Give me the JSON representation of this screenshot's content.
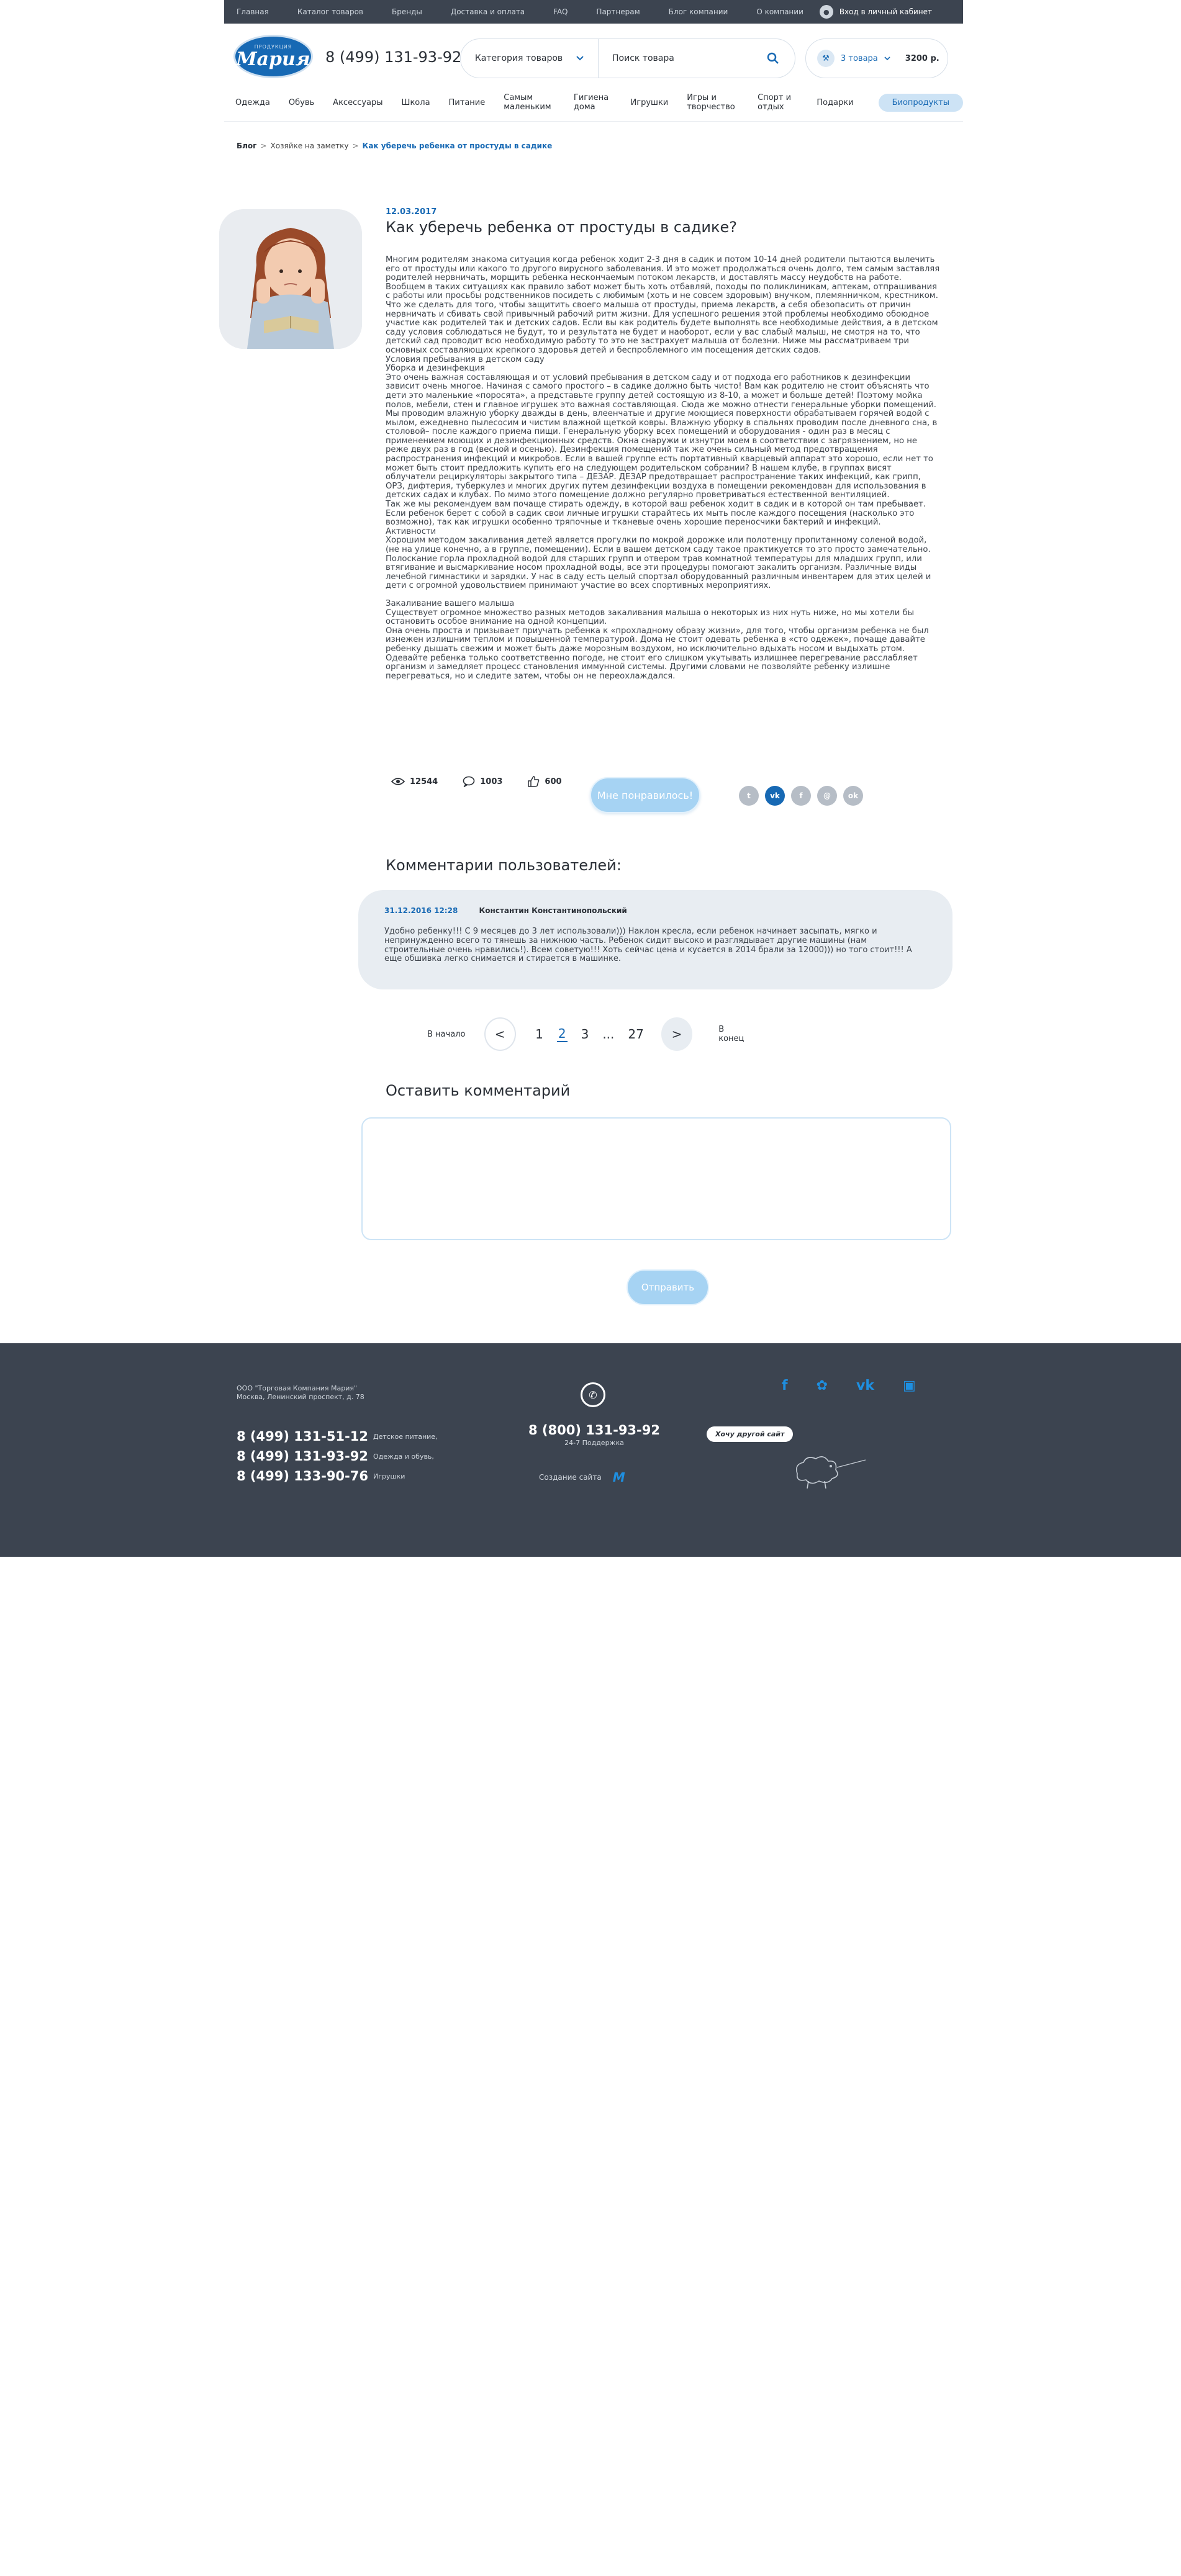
{
  "topbar": {
    "nav": [
      "Главная",
      "Каталог товаров",
      "Бренды",
      "Доставка и оплата",
      "FAQ",
      "Партнерам",
      "Блог компании",
      "О компании"
    ],
    "login": "Вход в личный кабинет"
  },
  "header": {
    "logo_sub": "ПРОДУКЦИЯ",
    "logo_main": "Мария",
    "phone": "8 (499) 131-93-92",
    "category_select": "Категория товаров",
    "search_placeholder": "Поиск товара",
    "cart_items": "3 товара",
    "cart_sum": "3200 р."
  },
  "catnav": [
    "Одежда",
    "Обувь",
    "Аксессуары",
    "Школа",
    "Питание",
    "Самым маленьким",
    "Гигиена дома",
    "Игрушки",
    "Игры и творчество",
    "Спорт и отдых",
    "Подарки"
  ],
  "catnav_highlight": "Биопродукты",
  "breadcrumb": {
    "root": "Блог",
    "section": "Хозяйке на заметку",
    "current": "Как уберечь ребенка от простуды в садике"
  },
  "article": {
    "date": "12.03.2017",
    "title": "Как уберечь ребенка от простуды в садике?",
    "paragraphs": [
      "Многим родителям знакома ситуация когда ребенок ходит 2-3 дня в садик и потом 10-14 дней родители пытаются вылечить его от простуды или какого то другого вирусного заболевания. И это может продолжаться очень долго, тем самым заставляя родителей нервничать, морщить ребенка нескончаемым потоком лекарств, и доставлять массу неудобств на работе. Вообщем в таких ситуациях как правило забот может быть хоть отбавляй, походы по поликлиникам, аптекам, отпрашивания с работы или просьбы родственников посидеть с любимым (хоть и не совсем здоровым) внучком, племянничком, крестником.",
      "Что же сделать для того, чтобы защитить своего малыша от простуды, приема лекарств, а себя обезопасить от причин нервничать и сбивать свой привычный рабочий ритм жизни. Для успешного решения этой проблемы необходимо обоюдное участие как родителей так и детских садов. Если вы как родитель будете выполнять все необходимые действия, а в детском саду условия соблюдаться не будут, то и результата не будет и наоборот, если у вас слабый малыш, не смотря на то, что детский сад проводит всю необходимую работу то это не застрахует малыша от болезни. Ниже мы рассматриваем три основных составляющих крепкого здоровья детей и беспроблемного им посещения детских садов.",
      "Условия пребывания в детском саду",
      "Уборка и дезинфекция",
      "Это очень важная составляющая и от условий пребывания в детском саду и от подхода его работников к дезинфекции зависит очень многое. Начиная с самого простого – в садике должно быть чисто! Вам как родителю не стоит объяснять что дети это маленькие «поросята», а представьте группу детей состоящую из 8-10, а может и больше детей! Поэтому мойка полов, мебели, стен и главное игрушек это важная составляющая. Сюда же можно отнести генеральные уборки помещений. Мы проводим влажную уборку дважды в день, влеенчатые и другие моющиеся поверхности обрабатываем горячей водой с мылом, ежедневно пылесосим и чистим влажной щеткой ковры. Влажную уборку в спальнях проводим после дневного сна, в столовой– после каждого приема пищи. Генеральную уборку всех помещений и оборудования - один раз в месяц с применением моющих и дезинфекционных средств. Окна снаружи и изнутри моем в соответствии с загрязнением, но не реже двух раз в год (весной и осенью). Дезинфекция помещений так же очень сильный метод предотвращения распространения инфекций и микробов. Если в вашей группе есть портативный кварцевый аппарат это хорошо, если нет то может быть стоит предложить купить его на следующем родительском собрании? В нашем клубе, в группах висят облучатели рециркуляторы закрытого типа – ДЕЗАР. ДЕЗАР предотвращает распространение таких инфекций, как грипп, ОРЗ, дифтерия, туберкулез и многих других путем дезинфекции воздуха в помещении рекомендован для использования в детских садах и клубах. По мимо этого помещение должно регулярно проветриваться естественной вентиляцией.",
      "Так же мы рекомендуем вам почаще стирать одежду, в которой ваш ребенок ходит в садик и в которой он там пребывает. Если ребенок берет с собой в садик свои личные игрушки старайтесь их мыть после каждого посещения (насколько это возможно), так как игрушки особенно тряпочные и тканевые очень хорошие переносчики бактерий и инфекций.",
      "Активности",
      "Хорошим методом закаливания детей является прогулки по мокрой дорожке или полотенцу пропитанному соленой водой, (не на улице конечно, а в группе, помещении). Если в вашем детском саду такое практикуется то это просто замечательно. Полоскание горла прохладной водой для старших групп и отвером трав комнатной температуры для младших групп, или втягивание и высмаркивание носом прохладной воды, все эти процедуры помогают закалить организм. Различные виды лечебной гимнастики и зарядки. У нас в саду есть целый спортзал оборудованный различным инвентарем для этих целей и дети с огромной удовольствием принимают участие во всех спортивных мероприятиях.",
      "",
      "Закаливание вашего малыша",
      "Существует огромное множество разных методов закаливания малыша о некоторых из них нуть ниже, но мы хотели бы остановить особое внимание на одной концепции.",
      "Она очень проста и призывает приучать ребенка к «прохладному образу жизни», для того, чтобы организм ребенка не был изнежен излишним теплом и повышенной температурой. Дома не стоит одевать ребенка в «сто одежек», почаще давайте ребенку дышать свежим и может быть даже морозным воздухом, но исключительно вдыхать носом и выдыхать ртом. Одевайте ребенка только соответственно погоде, не стоит его слишком укутывать излишнее перегревание расслабляет организм и замедляет процесс становления иммунной системы. Другими словами не позволяйте ребенку излишне перегреваться, но и следите затем, чтобы он не переохлаждался."
    ]
  },
  "stats": {
    "views": "12544",
    "comments": "1003",
    "likes": "600",
    "like_button": "Мне понравилось!"
  },
  "socials": [
    "t",
    "vk",
    "f",
    "@",
    "ok"
  ],
  "comments": {
    "heading": "Комментарии пользователей:",
    "items": [
      {
        "date": "31.12.2016 12:28",
        "author": "Константин Константинопольский",
        "text": "Удобно ребенку!!! С 9 месяцев до 3 лет использовали))) Наклон кресла, если ребенок начинает засыпать, мягко и непринужденно всего то тянешь за нижнюю часть. Ребенок сидит высоко и разглядывает другие машины (нам строительные очень нравились!). Всем советую!!! Хоть сейчас цена и кусается в 2014 брали за 12000))) но того стоит!!! А еще обшивка легко снимается и стирается в машинке."
      }
    ]
  },
  "pager": {
    "first": "В начало",
    "prev": "<",
    "pages": [
      "1",
      "2",
      "3",
      "...",
      "27"
    ],
    "active": "2",
    "next": ">",
    "last": "В конец"
  },
  "leave_comment": {
    "heading": "Оставить комментарий",
    "submit": "Отправить"
  },
  "footer": {
    "company_line1": "ООО \"Торговая Компания Мария\"",
    "company_line2": "Москва, Ленинский проспект, д. 78",
    "phones": [
      {
        "number": "8 (499) 131-51-12",
        "label": "Детское питание,"
      },
      {
        "number": "8 (499) 131-93-92",
        "label": "Одежда и обувь,"
      },
      {
        "number": "8 (499) 133-90-76",
        "label": "Игрушки"
      }
    ],
    "support_phone": "8 (800) 131-93-92",
    "support_label": "24-7 Поддержка",
    "created_label": "Создание сайта",
    "bubble": "Хочу другой сайт",
    "accent_color": "#1769b4",
    "dark_color": "#3c4450"
  }
}
